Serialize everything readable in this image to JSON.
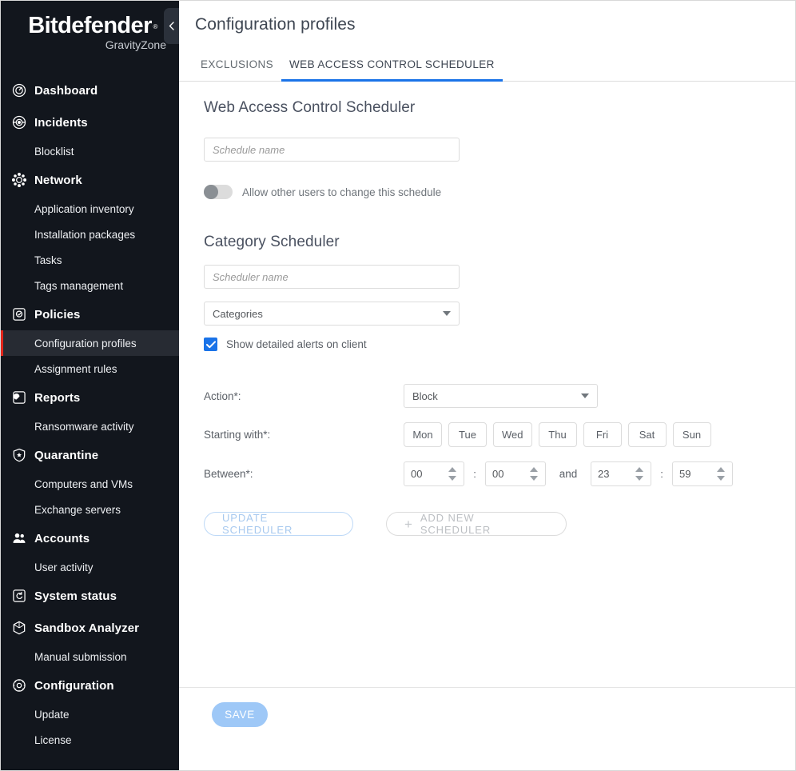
{
  "sidebar": {
    "brand": "Bitdefender",
    "brand_trademark": "®",
    "brand_sub": "GravityZone",
    "collapse_icon": "chevron-left-icon",
    "items": [
      {
        "label": "Dashboard",
        "level": "top",
        "icon": "dashboard-gauge-icon",
        "active": false
      },
      {
        "label": "Incidents",
        "level": "top",
        "icon": "incidents-radar-icon",
        "active": false
      },
      {
        "label": "Blocklist",
        "level": "sub",
        "icon": "",
        "active": false
      },
      {
        "label": "Network",
        "level": "top",
        "icon": "network-nodes-icon",
        "active": false
      },
      {
        "label": "Application inventory",
        "level": "sub",
        "icon": "",
        "active": false
      },
      {
        "label": "Installation packages",
        "level": "sub",
        "icon": "",
        "active": false
      },
      {
        "label": "Tasks",
        "level": "sub",
        "icon": "",
        "active": false
      },
      {
        "label": "Tags management",
        "level": "sub",
        "icon": "",
        "active": false
      },
      {
        "label": "Policies",
        "level": "top",
        "icon": "policies-check-square-icon",
        "active": false
      },
      {
        "label": "Configuration profiles",
        "level": "sub",
        "icon": "",
        "active": true
      },
      {
        "label": "Assignment rules",
        "level": "sub",
        "icon": "",
        "active": false
      },
      {
        "label": "Reports",
        "level": "top",
        "icon": "reports-square-icon",
        "active": false
      },
      {
        "label": "Ransomware activity",
        "level": "sub",
        "icon": "",
        "active": false
      },
      {
        "label": "Quarantine",
        "level": "top",
        "icon": "quarantine-shield-icon",
        "active": false
      },
      {
        "label": "Computers and VMs",
        "level": "sub",
        "icon": "",
        "active": false
      },
      {
        "label": "Exchange servers",
        "level": "sub",
        "icon": "",
        "active": false
      },
      {
        "label": "Accounts",
        "level": "top",
        "icon": "accounts-people-icon",
        "active": false
      },
      {
        "label": "User activity",
        "level": "sub",
        "icon": "",
        "active": false
      },
      {
        "label": "System status",
        "level": "top",
        "icon": "system-status-refresh-icon",
        "active": false
      },
      {
        "label": "Sandbox Analyzer",
        "level": "top",
        "icon": "sandbox-cube-icon",
        "active": false
      },
      {
        "label": "Manual submission",
        "level": "sub",
        "icon": "",
        "active": false
      },
      {
        "label": "Configuration",
        "level": "top",
        "icon": "configuration-gear-icon",
        "active": false
      },
      {
        "label": "Update",
        "level": "sub",
        "icon": "",
        "active": false
      },
      {
        "label": "License",
        "level": "sub",
        "icon": "",
        "active": false
      }
    ]
  },
  "header": {
    "title": "Configuration profiles"
  },
  "tabs": [
    {
      "label": "EXCLUSIONS",
      "active": false
    },
    {
      "label": "WEB ACCESS CONTROL SCHEDULER",
      "active": true
    }
  ],
  "main": {
    "section_title": "Web Access Control Scheduler",
    "schedule_name": {
      "value": "",
      "placeholder": "Schedule name"
    },
    "allow_toggle": {
      "label": "Allow other users to change this schedule",
      "on": false
    },
    "category_section_title": "Category Scheduler",
    "scheduler_name": {
      "value": "",
      "placeholder": "Scheduler name"
    },
    "categories_select": {
      "value": "Categories",
      "icon": "chevron-down-icon"
    },
    "show_alerts_checkbox": {
      "label": "Show detailed alerts on client",
      "checked": true
    },
    "form": {
      "action_label": "Action*:",
      "action_value": "Block",
      "starting_with_label": "Starting with*:",
      "days": [
        "Mon",
        "Tue",
        "Wed",
        "Thu",
        "Fri",
        "Sat",
        "Sun"
      ],
      "between_label": "Between*:",
      "start_hour": "00",
      "start_minute": "00",
      "and_text": "and",
      "end_hour": "23",
      "end_minute": "59",
      "time_separator": ":"
    },
    "buttons": {
      "update_scheduler": "UPDATE SCHEDULER",
      "add_new_scheduler": "ADD NEW SCHEDULER",
      "add_icon": "plus-icon"
    }
  },
  "footer": {
    "save_label": "SAVE"
  },
  "colors": {
    "sidebar_bg": "#12161d",
    "accent_blue": "#1a73e8",
    "active_red": "#e1251b",
    "save_bg": "#9ec8f7"
  }
}
